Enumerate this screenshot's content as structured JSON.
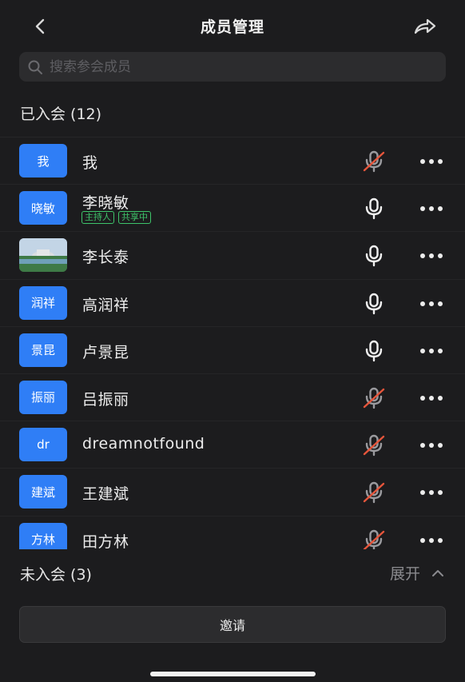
{
  "header": {
    "title": "成员管理",
    "back_icon": "chevron-left-icon",
    "share_icon": "share-arrow-icon"
  },
  "search": {
    "placeholder": "搜索参会成员",
    "icon": "search-icon"
  },
  "joined": {
    "title": "已入会 (12)",
    "members": [
      {
        "avatar": "我",
        "name": "我",
        "mic": "muted"
      },
      {
        "avatar": "晓敏",
        "name": "李晓敏",
        "mic": "on",
        "tags": [
          "主持人",
          "共享中"
        ]
      },
      {
        "avatar": "photo",
        "name": "李长泰",
        "mic": "on"
      },
      {
        "avatar": "润祥",
        "name": "高润祥",
        "mic": "on"
      },
      {
        "avatar": "景昆",
        "name": "卢景昆",
        "mic": "on"
      },
      {
        "avatar": "振丽",
        "name": "吕振丽",
        "mic": "muted"
      },
      {
        "avatar": "dr",
        "name": "dreamnotfound",
        "mic": "muted"
      },
      {
        "avatar": "建斌",
        "name": "王建斌",
        "mic": "muted"
      },
      {
        "avatar": "方林",
        "name": "田方林",
        "mic": "muted"
      }
    ]
  },
  "not_joined": {
    "title": "未入会 (3)",
    "expand_label": "展开"
  },
  "invite": {
    "label": "邀请"
  },
  "colors": {
    "background": "#1c1c1e",
    "avatar_blue": "#2f7ef6",
    "tag_green": "#3ec46a",
    "muted_red": "#e5553b"
  }
}
